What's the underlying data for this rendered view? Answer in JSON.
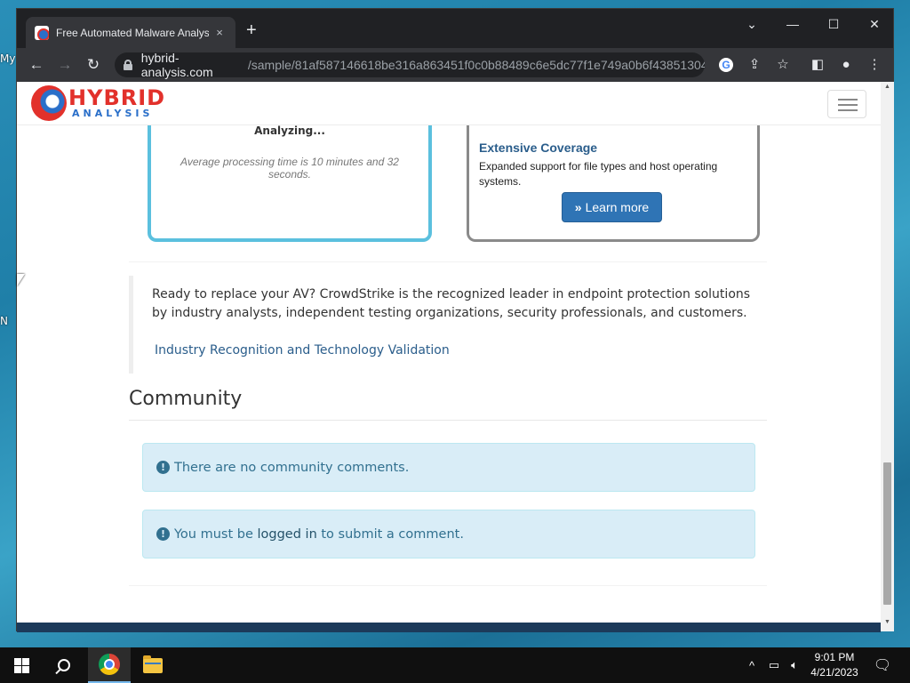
{
  "desktop": {
    "fragments": [
      "My",
      "N"
    ]
  },
  "browser": {
    "tab_title": "Free Automated Malware Analysis",
    "tab_close": "×",
    "new_tab": "+",
    "window_controls": {
      "dropdown": "⌄",
      "minimize": "—",
      "maximize": "☐",
      "close": "✕"
    },
    "nav": {
      "back": "←",
      "forward": "→",
      "reload": "↻"
    },
    "url": {
      "host": "hybrid-analysis.com",
      "path": "/sample/81af587146618be316a863451f0c0b88489c6e5dc77f1e749a0b6f43851304..."
    },
    "omnibox_icons": [
      "google-icon",
      "share-icon",
      "star-icon"
    ],
    "toolbar_icons": [
      "sidepanel-icon",
      "profile-icon",
      "menu-icon"
    ]
  },
  "site": {
    "logo": {
      "word1": "HYBRID",
      "word2": "ANALYSIS"
    },
    "menu_icon": "hamburger-icon"
  },
  "cards": {
    "left": {
      "cut_text": "Analyzing...",
      "processing_note": "Average processing time is 10 minutes and 32 seconds."
    },
    "right": {
      "heading": "Extensive Coverage",
      "description": "Expanded support for file types and host operating systems.",
      "button_icon": "»",
      "button_label": "Learn more"
    }
  },
  "promo": {
    "text": "Ready to replace your AV? CrowdStrike is the recognized leader in endpoint protection solutions by industry analysts, independent testing organizations, security professionals, and customers.",
    "link": "Industry Recognition and Technology Validation"
  },
  "community": {
    "title": "Community",
    "no_comments": "There are no community comments.",
    "login_prefix": "You must be",
    "login_link": "logged in",
    "login_suffix": "to submit a comment."
  },
  "taskbar": {
    "time": "9:01 PM",
    "date": "4/21/2023",
    "tray_up": "^",
    "accent": "#76b9ed"
  }
}
